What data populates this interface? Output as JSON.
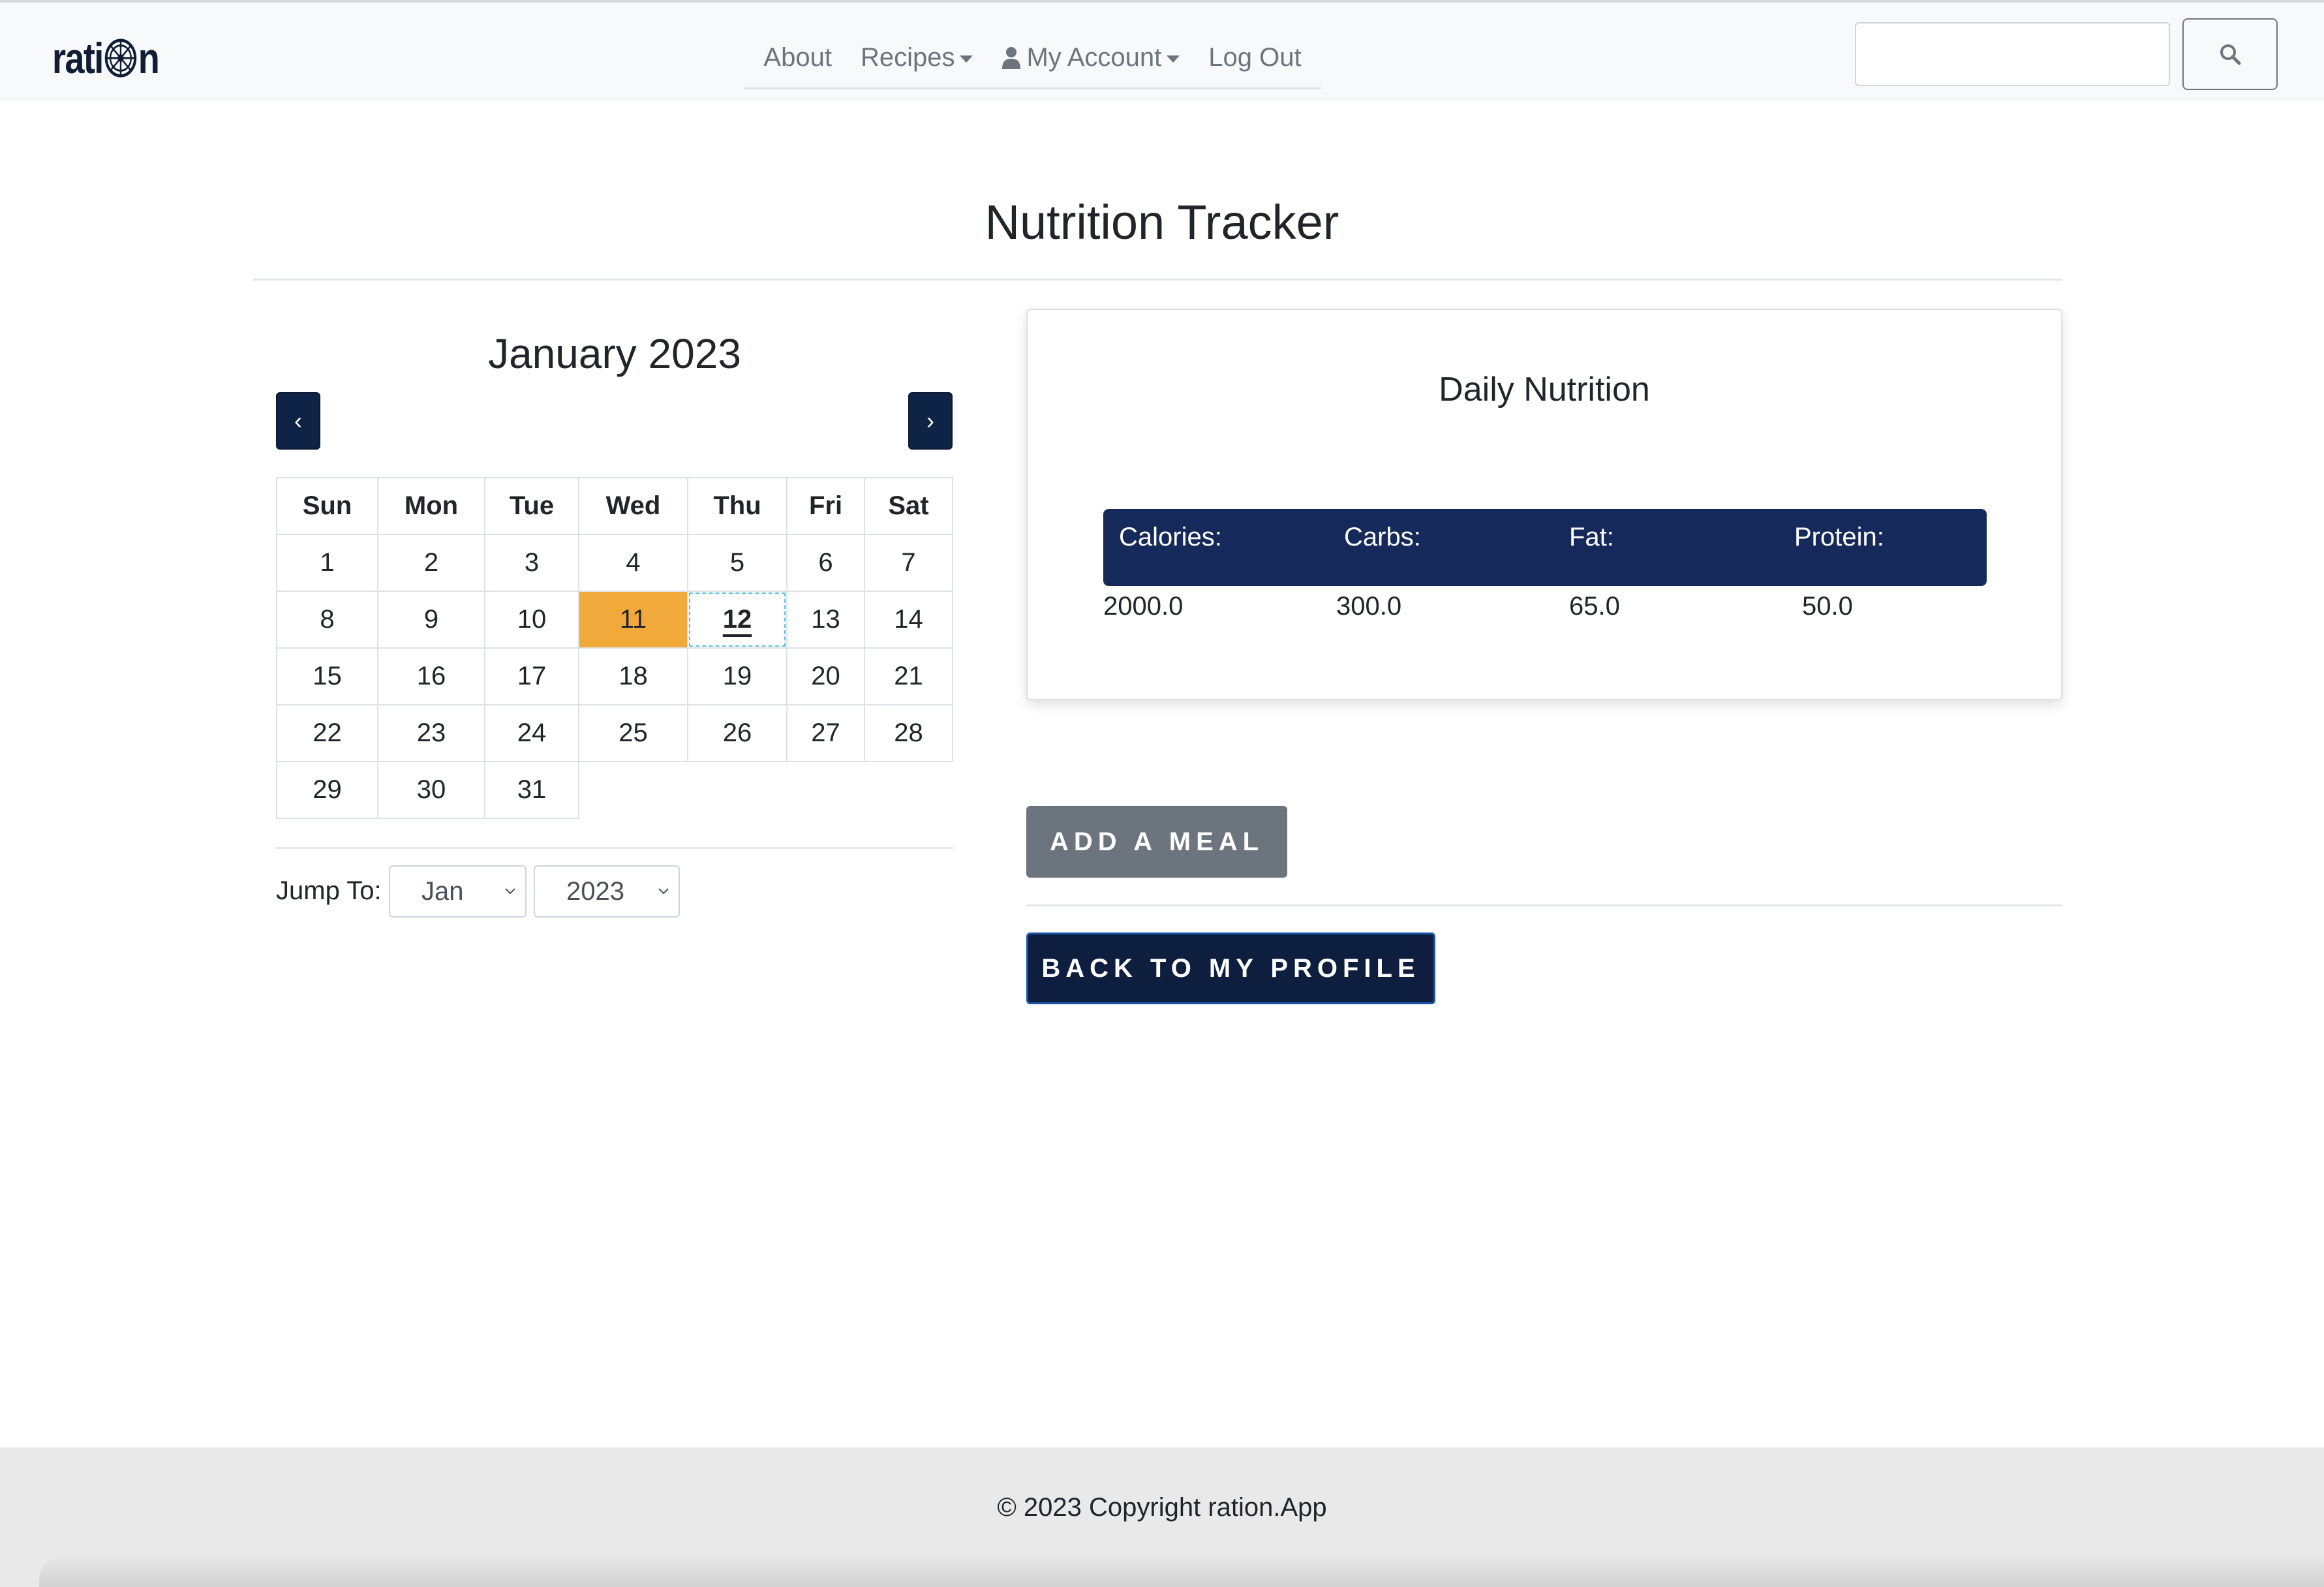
{
  "brand": {
    "logo_prefix": "rati",
    "logo_suffix": "n"
  },
  "nav": {
    "items": [
      {
        "label": "About"
      },
      {
        "label": "Recipes"
      },
      {
        "label": "My Account"
      },
      {
        "label": "Log Out"
      }
    ],
    "search": {
      "placeholder": "",
      "value": ""
    },
    "search_button_icon": "search-icon"
  },
  "page": {
    "title": "Nutrition Tracker"
  },
  "calendar": {
    "month_label": "January 2023",
    "prev_label": "‹",
    "next_label": "›",
    "weekdays": [
      "Sun",
      "Mon",
      "Tue",
      "Wed",
      "Thu",
      "Fri",
      "Sat"
    ],
    "weeks": [
      [
        "1",
        "2",
        "3",
        "4",
        "5",
        "6",
        "7"
      ],
      [
        "8",
        "9",
        "10",
        "11",
        "12",
        "13",
        "14"
      ],
      [
        "15",
        "16",
        "17",
        "18",
        "19",
        "20",
        "21"
      ],
      [
        "22",
        "23",
        "24",
        "25",
        "26",
        "27",
        "28"
      ],
      [
        "29",
        "30",
        "31",
        "",
        "",
        "",
        ""
      ]
    ],
    "selected_day": "11",
    "today_day": "12",
    "selected_color": "#f2a93b",
    "jump_label": "Jump To:",
    "jump_month": "Jan",
    "jump_year": "2023"
  },
  "nutrition": {
    "title": "Daily Nutrition",
    "headers": [
      "Calories:",
      "Carbs:",
      "Fat:",
      "Protein:"
    ],
    "values": [
      "2000.0",
      "300.0",
      "65.0",
      "50.0"
    ],
    "header_color": "#15295a"
  },
  "actions": {
    "add_meal": "ADD A MEAL",
    "back_profile": "BACK TO MY PROFILE"
  },
  "footer": {
    "text": "© 2023 Copyright ration.App"
  }
}
